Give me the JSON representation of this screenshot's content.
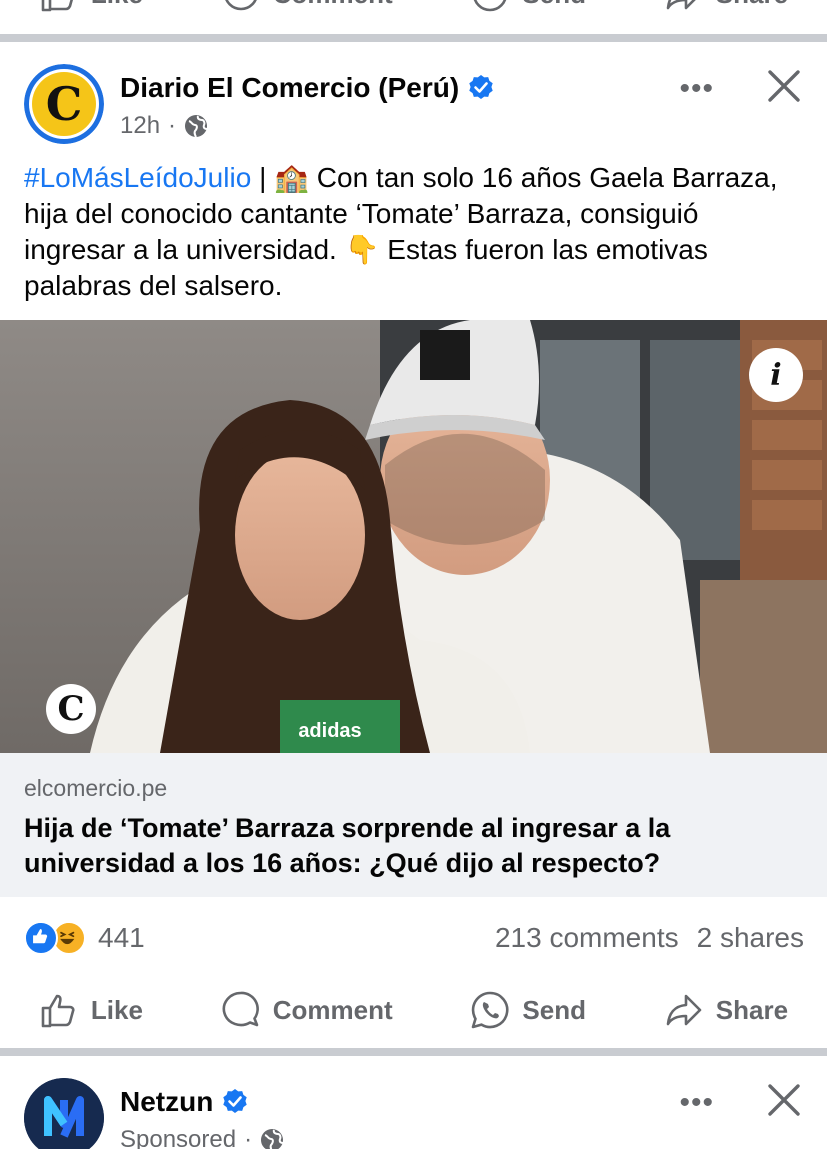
{
  "top_actions": {
    "like": "Like",
    "comment": "Comment",
    "send": "Send",
    "share": "Share"
  },
  "post": {
    "page_name": "Diario El Comercio (Perú)",
    "time": "12h",
    "separator": "·",
    "caption": {
      "hashtag": "#LoMásLeídoJulio",
      "pipe": "|",
      "emoji_school": "🏫",
      "text_1": "Con tan solo 16 años Gaela Barraza, hija del conocido cantante ‘Tomate’ Barraza, consiguió ingresar a la universidad.",
      "emoji_point": "👇",
      "text_2": "Estas fueron las emotivas palabras del salsero."
    },
    "image": {
      "info_glyph": "i",
      "watermark_glyph": "C",
      "shirt_text": "adidas"
    },
    "link": {
      "domain": "elcomercio.pe",
      "title": "Hija de ‘Tomate’ Barraza sorprende al ingresar a la universidad a los 16 años: ¿Qué dijo al respecto?"
    },
    "stats": {
      "reaction_count": "441",
      "comments": "213 comments",
      "shares": "2 shares"
    },
    "actions": {
      "like": "Like",
      "comment": "Comment",
      "send": "Send",
      "share": "Share"
    },
    "more_glyph": "•••"
  },
  "next_post": {
    "page_name": "Netzun",
    "meta": "Sponsored",
    "separator": "·",
    "more_glyph": "•••"
  },
  "colors": {
    "accent": "#1877f2",
    "secondary_text": "#65676b",
    "card_bg": "#f0f2f5",
    "divider": "#c9ccd1"
  }
}
